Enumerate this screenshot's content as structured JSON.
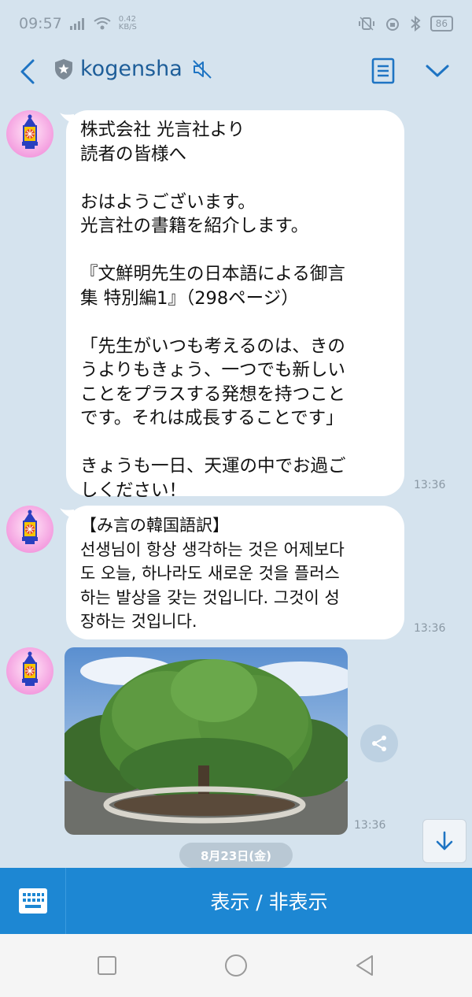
{
  "status_bar": {
    "time": "09:57",
    "net_speed_value": "0.42",
    "net_speed_unit": "KB/S",
    "battery": "86"
  },
  "header": {
    "title": "kogensha",
    "icons": [
      "back-arrow-icon",
      "shield-star-icon",
      "muted-icon",
      "notes-icon",
      "chevron-down-icon"
    ]
  },
  "messages": [
    {
      "text": "株式会社 光言社より\n読者の皆様へ\n\nおはようございます。\n光言社の書籍を紹介します。\n\n『文鮮明先生の日本語による御言\n集 特別編1』（298ページ）\n\n「先生がいつも考えるのは、きの\nうよりもきょう、一つでも新しい\nことをプラスする発想を持つこと\nです。それは成長することです」\n\nきょうも一日、天運の中でお過ご\nしください！",
      "time": "13:36"
    },
    {
      "text": "【み言の韓国語訳】\n선생님이 항상 생각하는 것은 어제보다\n도 오늘, 하나라도 새로운 것을 플러스\n하는 발상을 갖는 것입니다. 그것이 성\n장하는 것입니다.",
      "time": "13:36"
    },
    {
      "type": "image",
      "time": "13:36"
    }
  ],
  "date_separator": "8月23日(金)",
  "action_bar": {
    "toggle_label": "表示 / 非表示"
  },
  "colors": {
    "background": "#d5e3ee",
    "accent": "#1d87d3",
    "title": "#1e5e99"
  }
}
